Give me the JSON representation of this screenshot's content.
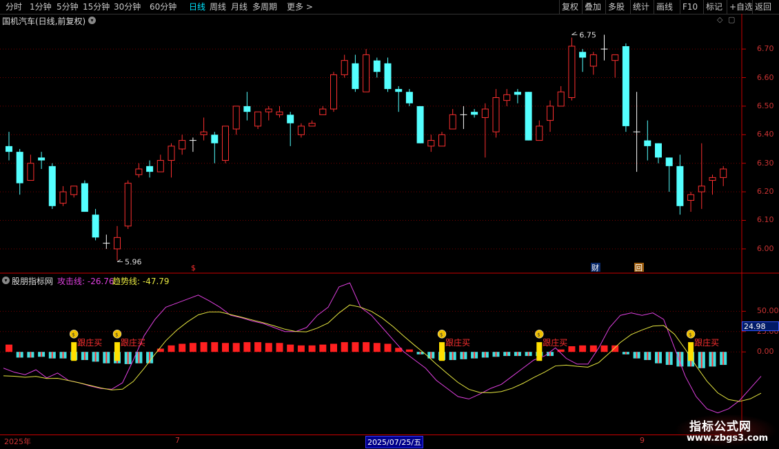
{
  "toolbar": {
    "periods": [
      "分时",
      "1分钟",
      "5分钟",
      "15分钟",
      "30分钟",
      "60分钟",
      "日线",
      "周线",
      "月线",
      "多周期",
      "更多 >"
    ],
    "active_period": "日线",
    "right_buttons": [
      "复权",
      "叠加",
      "多股",
      "统计",
      "画线",
      "F10",
      "标记",
      "+自选",
      "返回"
    ]
  },
  "stock": {
    "title": "国机汽车(日线,前复权)",
    "high_label": "6.75",
    "low_label": "5.96"
  },
  "price_axis": {
    "ticks": [
      "6.70",
      "6.60",
      "6.50",
      "6.40",
      "6.30",
      "6.20",
      "6.10",
      "6.00"
    ]
  },
  "markers": {
    "s_marker": "$",
    "cai_marker": "财",
    "hui_marker": "回"
  },
  "indicator": {
    "name": "股朋指标网",
    "line1_label": "攻击线: -26.76",
    "line2_label": "趋势线: -47.79",
    "ticks": [
      "50.00",
      "25.00",
      "0.00"
    ],
    "current_value": "24.98",
    "signal_text": "跟庄买",
    "colors": {
      "attack": "#e040e0",
      "trend": "#e8e840",
      "up": "#ff2020",
      "down": "#40e0e0",
      "signal": "#ffe000"
    }
  },
  "date_axis": {
    "labels": [
      "2025年",
      "7",
      "2025/07/25/五",
      "9"
    ]
  },
  "watermark": {
    "line1": "指标公式网",
    "line2": "www.zbgs3.com"
  },
  "chart_data": {
    "type": "candlestick",
    "ylim": [
      5.92,
      6.78
    ],
    "candles": [
      [
        6.36,
        6.41,
        6.31,
        6.34
      ],
      [
        6.34,
        6.35,
        6.19,
        6.23
      ],
      [
        6.24,
        6.33,
        6.25,
        6.3
      ],
      [
        6.32,
        6.34,
        6.28,
        6.31
      ],
      [
        6.29,
        6.3,
        6.14,
        6.15
      ],
      [
        6.16,
        6.22,
        6.15,
        6.2
      ],
      [
        6.19,
        6.22,
        6.18,
        6.22
      ],
      [
        6.23,
        6.24,
        6.13,
        6.13
      ],
      [
        6.12,
        6.14,
        6.03,
        6.04
      ],
      [
        6.02,
        6.05,
        6.0,
        6.02
      ],
      [
        6.0,
        6.08,
        5.96,
        6.04
      ],
      [
        6.08,
        6.24,
        6.07,
        6.23
      ],
      [
        6.26,
        6.3,
        6.25,
        6.28
      ],
      [
        6.29,
        6.31,
        6.25,
        6.27
      ],
      [
        6.27,
        6.33,
        6.27,
        6.31
      ],
      [
        6.31,
        6.37,
        6.25,
        6.36
      ],
      [
        6.35,
        6.4,
        6.33,
        6.38
      ],
      [
        6.38,
        6.39,
        6.34,
        6.38
      ],
      [
        6.4,
        6.46,
        6.38,
        6.41
      ],
      [
        6.4,
        6.41,
        6.3,
        6.37
      ],
      [
        6.31,
        6.43,
        6.3,
        6.43
      ],
      [
        6.42,
        6.5,
        6.4,
        6.5
      ],
      [
        6.5,
        6.55,
        6.45,
        6.48
      ],
      [
        6.43,
        6.48,
        6.42,
        6.48
      ],
      [
        6.48,
        6.5,
        6.45,
        6.49
      ],
      [
        6.47,
        6.5,
        6.46,
        6.48
      ],
      [
        6.47,
        6.48,
        6.36,
        6.44
      ],
      [
        6.4,
        6.44,
        6.39,
        6.43
      ],
      [
        6.43,
        6.45,
        6.43,
        6.44
      ],
      [
        6.47,
        6.5,
        6.47,
        6.49
      ],
      [
        6.49,
        6.62,
        6.48,
        6.61
      ],
      [
        6.61,
        6.68,
        6.6,
        6.66
      ],
      [
        6.65,
        6.68,
        6.55,
        6.56
      ],
      [
        6.55,
        6.7,
        6.55,
        6.68
      ],
      [
        6.66,
        6.67,
        6.6,
        6.62
      ],
      [
        6.65,
        6.67,
        6.55,
        6.56
      ],
      [
        6.56,
        6.57,
        6.48,
        6.55
      ],
      [
        6.55,
        6.56,
        6.5,
        6.51
      ],
      [
        6.5,
        6.5,
        6.37,
        6.37
      ],
      [
        6.36,
        6.4,
        6.34,
        6.38
      ],
      [
        6.36,
        6.41,
        6.36,
        6.4
      ],
      [
        6.42,
        6.49,
        6.42,
        6.47
      ],
      [
        6.47,
        6.5,
        6.42,
        6.47
      ],
      [
        6.48,
        6.49,
        6.46,
        6.47
      ],
      [
        6.46,
        6.51,
        6.32,
        6.49
      ],
      [
        6.41,
        6.56,
        6.39,
        6.53
      ],
      [
        6.52,
        6.56,
        6.5,
        6.54
      ],
      [
        6.55,
        6.56,
        6.51,
        6.54
      ],
      [
        6.55,
        6.55,
        6.38,
        6.38
      ],
      [
        6.38,
        6.45,
        6.38,
        6.43
      ],
      [
        6.45,
        6.52,
        6.41,
        6.5
      ],
      [
        6.5,
        6.57,
        6.5,
        6.55
      ],
      [
        6.53,
        6.74,
        6.52,
        6.71
      ],
      [
        6.69,
        6.7,
        6.62,
        6.67
      ],
      [
        6.64,
        6.69,
        6.61,
        6.68
      ],
      [
        6.7,
        6.75,
        6.66,
        6.7
      ],
      [
        6.66,
        6.68,
        6.6,
        6.68
      ],
      [
        6.71,
        6.72,
        6.41,
        6.43
      ],
      [
        6.41,
        6.55,
        6.27,
        6.41
      ],
      [
        6.38,
        6.45,
        6.31,
        6.36
      ],
      [
        6.37,
        6.37,
        6.3,
        6.32
      ],
      [
        6.32,
        6.32,
        6.2,
        6.29
      ],
      [
        6.29,
        6.33,
        6.12,
        6.15
      ],
      [
        6.17,
        6.2,
        6.13,
        6.19
      ],
      [
        6.2,
        6.37,
        6.14,
        6.22
      ],
      [
        6.24,
        6.26,
        6.19,
        6.25
      ],
      [
        6.25,
        6.29,
        6.22,
        6.28
      ]
    ],
    "indicator_bars": [
      9,
      -7,
      -7,
      -6,
      -8,
      -8,
      -10,
      -10,
      -12,
      -14,
      -14,
      -15,
      -14,
      -14,
      4,
      8,
      10,
      11,
      12,
      12,
      11,
      11,
      12,
      12,
      11,
      11,
      9,
      8,
      8,
      9,
      10,
      12,
      12,
      12,
      11,
      10,
      5,
      3,
      -3,
      -8,
      -10,
      -10,
      -9,
      -8,
      -7,
      -6,
      -5,
      -5,
      -5,
      -5,
      -5,
      3,
      7,
      8,
      8,
      8,
      8,
      -3,
      -8,
      -10,
      -14,
      -16,
      -18,
      -18,
      -20,
      -18,
      -16
    ],
    "attack_line": [
      -20,
      -25,
      -28,
      -22,
      -32,
      -26,
      -35,
      -38,
      -42,
      -45,
      -46,
      -38,
      -10,
      20,
      40,
      55,
      60,
      65,
      70,
      63,
      55,
      45,
      42,
      38,
      35,
      30,
      25,
      25,
      30,
      45,
      55,
      80,
      85,
      55,
      45,
      30,
      15,
      0,
      -10,
      -20,
      -35,
      -45,
      -55,
      -58,
      -52,
      -45,
      -40,
      -30,
      -20,
      -10,
      -5,
      5,
      -8,
      -15,
      -15,
      5,
      30,
      45,
      48,
      45,
      48,
      40,
      5,
      -30,
      -55,
      -70,
      -75,
      -70,
      -60,
      -45,
      -30
    ]
  }
}
